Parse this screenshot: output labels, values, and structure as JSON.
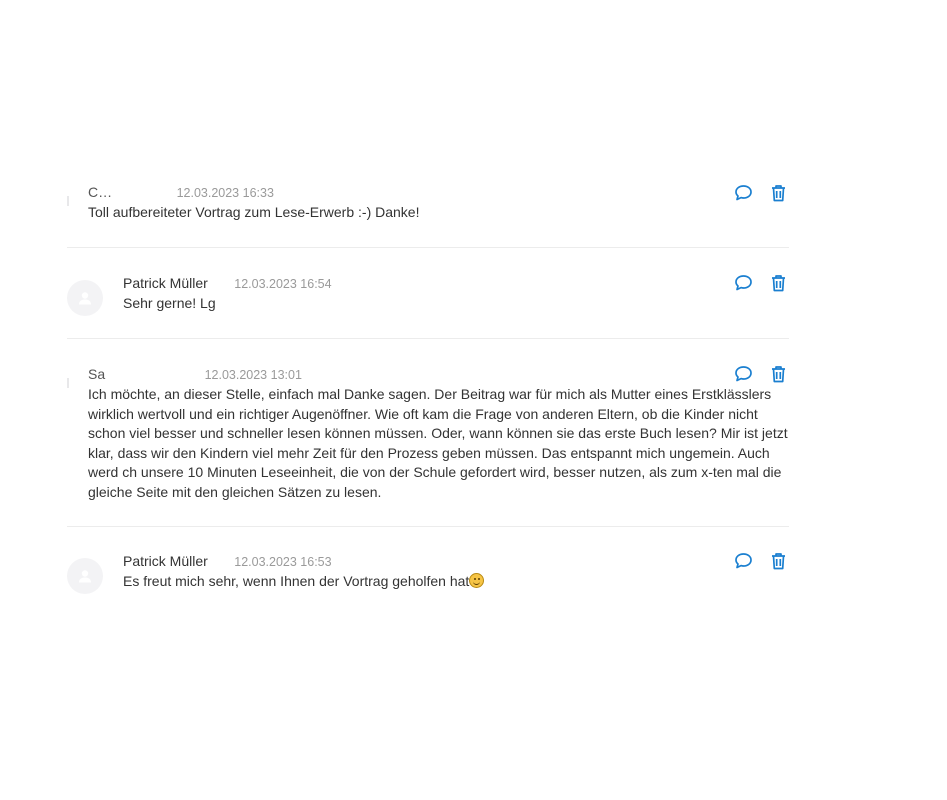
{
  "comments": [
    {
      "author": "C…",
      "date": "12.03.2023 16:33",
      "text": "Toll aufbereiteter Vortrag zum Lese-Erwerb :-) Danke!"
    },
    {
      "author": "Patrick Müller",
      "date": "12.03.2023 16:54",
      "text": "Sehr gerne! Lg"
    },
    {
      "author": "Sa",
      "date": "12.03.2023 13:01",
      "text": "Ich möchte, an dieser Stelle, einfach mal Danke sagen. Der Beitrag war für mich als Mutter eines Erstklässlers wirklich wertvoll und ein richtiger Augenöffner. Wie oft kam die Frage von anderen Eltern, ob die Kinder nicht schon viel besser und schneller lesen können müssen. Oder, wann können sie das erste Buch lesen? Mir ist jetzt klar, dass wir den Kindern viel mehr Zeit für den Prozess geben müssen. Das entspannt mich ungemein. Auch werd ch unsere 10 Minuten Leseeinheit, die von der Schule gefordert wird, besser nutzen, als zum x-ten mal die gleiche Seite mit den gleichen Sätzen zu lesen."
    },
    {
      "author": "Patrick Müller",
      "date": "12.03.2023 16:53",
      "text": "Es freut mich sehr, wenn Ihnen der Vortrag geholfen hat"
    }
  ],
  "icons": {
    "reply": "speech-bubble-icon",
    "delete": "trash-icon"
  },
  "colors": {
    "accent": "#1a7fd0",
    "date": "#9a9a9a",
    "divider": "#ececec"
  }
}
